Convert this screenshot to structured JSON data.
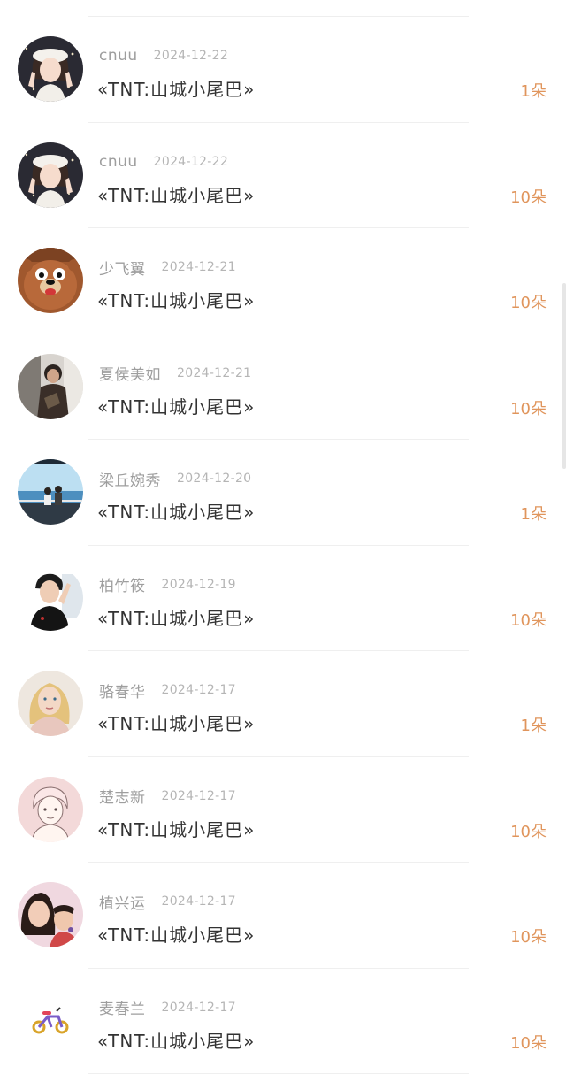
{
  "gift_records": [
    {
      "user": "cnuu",
      "date": "2024-12-22",
      "book": "«TNT:山城小尾巴»",
      "amount": "1朵",
      "avatar": "girl-white-beret"
    },
    {
      "user": "cnuu",
      "date": "2024-12-22",
      "book": "«TNT:山城小尾巴»",
      "amount": "10朵",
      "avatar": "girl-white-beret"
    },
    {
      "user": "少飞翼",
      "date": "2024-12-21",
      "book": "«TNT:山城小尾巴»",
      "amount": "10朵",
      "avatar": "cartoon-bear"
    },
    {
      "user": "夏侯美如",
      "date": "2024-12-21",
      "book": "«TNT:山城小尾巴»",
      "amount": "10朵",
      "avatar": "person-dark-coat"
    },
    {
      "user": "梁丘婉秀",
      "date": "2024-12-20",
      "book": "«TNT:山城小尾巴»",
      "amount": "1朵",
      "avatar": "couple-seaside"
    },
    {
      "user": "柏竹筱",
      "date": "2024-12-19",
      "book": "«TNT:山城小尾巴»",
      "amount": "10朵",
      "avatar": "boy-black-shirt"
    },
    {
      "user": "骆春华",
      "date": "2024-12-17",
      "book": "«TNT:山城小尾巴»",
      "amount": "1朵",
      "avatar": "blonde-woman"
    },
    {
      "user": "楚志新",
      "date": "2024-12-17",
      "book": "«TNT:山城小尾巴»",
      "amount": "10朵",
      "avatar": "sketch-boy"
    },
    {
      "user": "植兴运",
      "date": "2024-12-17",
      "book": "«TNT:山城小尾巴»",
      "amount": "10朵",
      "avatar": "selfie-pair"
    },
    {
      "user": "麦春兰",
      "date": "2024-12-17",
      "book": "«TNT:山城小尾巴»",
      "amount": "10朵",
      "avatar": "bicycle-icon"
    }
  ],
  "colors": {
    "username": "#9e9e9e",
    "date": "#b5b5b5",
    "book_title": "#333333",
    "amount": "#e0955c",
    "divider": "#efefef"
  }
}
